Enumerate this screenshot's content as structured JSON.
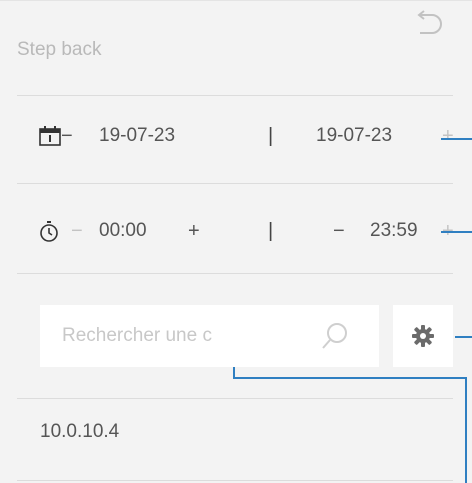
{
  "step_back": {
    "label": "Step back",
    "icon": "undo-icon"
  },
  "date_range": {
    "icon": "calendar-icon",
    "minus": "−",
    "plus": "+",
    "separator": "|",
    "start": "19-07-23",
    "end": "19-07-23"
  },
  "time_range": {
    "icon": "stopwatch-icon",
    "minus": "−",
    "plus": "+",
    "separator": "|",
    "start": "00:00",
    "end": "23:59"
  },
  "search": {
    "placeholder": "Rechercher une c",
    "icon": "search-icon"
  },
  "settings": {
    "icon": "gear-icon"
  },
  "list": {
    "items": [
      "10.0.10.4"
    ]
  },
  "colors": {
    "accent": "#2f7fc1",
    "background": "#f3f3f3",
    "muted": "#b9b9b9"
  }
}
